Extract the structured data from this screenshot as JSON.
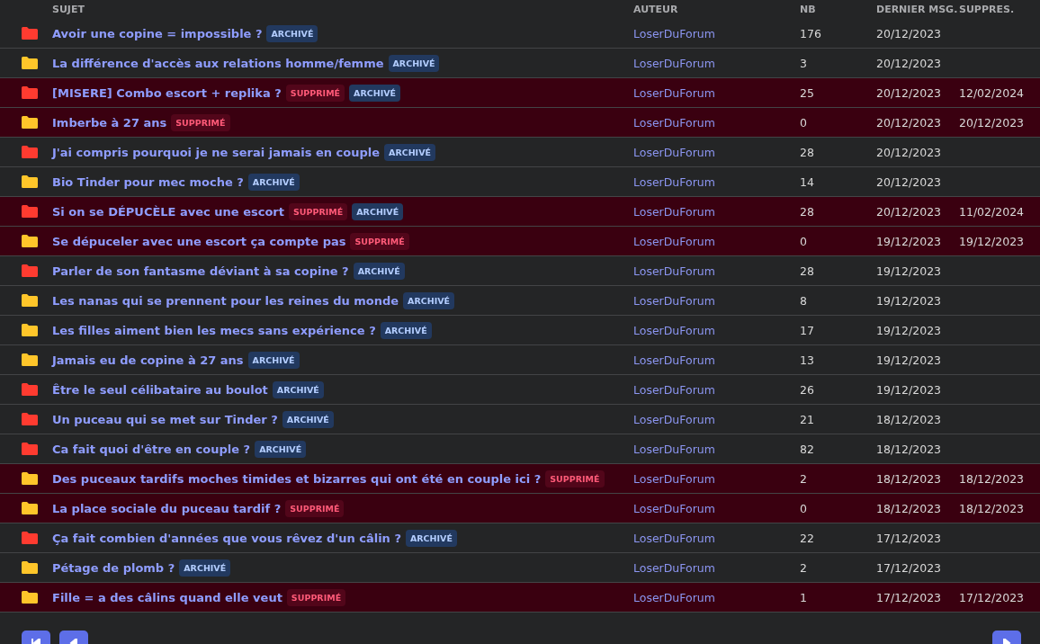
{
  "table": {
    "columns": [
      "SUJET",
      "AUTEUR",
      "NB",
      "DERNIER MSG.",
      "SUPPRES."
    ],
    "rows": [
      {
        "color": "#ff3b30",
        "title": "Avoir une copine = impossible ?",
        "deleted": false,
        "tags": [
          {
            "kind": "archived",
            "label": "ARCHIVÉ"
          }
        ],
        "author": "LoserDuForum",
        "count": "176",
        "last": "20/12/2023"
      },
      {
        "color": "#ffc62a",
        "title": "La différence d'accès aux relations homme/femme",
        "deleted": false,
        "tags": [
          {
            "kind": "archived",
            "label": "ARCHIVÉ"
          }
        ],
        "author": "LoserDuForum",
        "count": "3",
        "last": "20/12/2023"
      },
      {
        "color": "#ff3b30",
        "title": "[MISERE] Combo escort + replika ?",
        "deleted": true,
        "tags": [
          {
            "kind": "deleted",
            "label": "SUPPRIMÉ"
          },
          {
            "kind": "archived",
            "label": "ARCHIVÉ"
          }
        ],
        "author": "LoserDuForum",
        "count": "25",
        "last": "20/12/2023",
        "deleted_on": "12/02/2024"
      },
      {
        "color": "#ffc62a",
        "title": "Imberbe à 27 ans",
        "deleted": true,
        "tags": [
          {
            "kind": "deleted",
            "label": "SUPPRIMÉ"
          }
        ],
        "author": "LoserDuForum",
        "count": "0",
        "last": "20/12/2023",
        "deleted_on": "20/12/2023"
      },
      {
        "color": "#ff3b30",
        "title": "J'ai compris pourquoi je ne serai jamais en couple",
        "deleted": false,
        "tags": [
          {
            "kind": "archived",
            "label": "ARCHIVÉ"
          }
        ],
        "author": "LoserDuForum",
        "count": "28",
        "last": "20/12/2023"
      },
      {
        "color": "#ffc62a",
        "title": "Bio Tinder pour mec moche ?",
        "deleted": false,
        "tags": [
          {
            "kind": "archived",
            "label": "ARCHIVÉ"
          }
        ],
        "author": "LoserDuForum",
        "count": "14",
        "last": "20/12/2023"
      },
      {
        "color": "#ff3b30",
        "title": "Si on se DÉPUCÈLE avec une escort",
        "deleted": true,
        "tags": [
          {
            "kind": "deleted",
            "label": "SUPPRIMÉ"
          },
          {
            "kind": "archived",
            "label": "ARCHIVÉ"
          }
        ],
        "author": "LoserDuForum",
        "count": "28",
        "last": "20/12/2023",
        "deleted_on": "11/02/2024"
      },
      {
        "color": "#ffc62a",
        "title": "Se dépuceler avec une escort ça compte pas",
        "deleted": true,
        "tags": [
          {
            "kind": "deleted",
            "label": "SUPPRIMÉ"
          }
        ],
        "author": "LoserDuForum",
        "count": "0",
        "last": "19/12/2023",
        "deleted_on": "19/12/2023"
      },
      {
        "color": "#ff3b30",
        "title": "Parler de son fantasme déviant à sa copine ?",
        "deleted": false,
        "tags": [
          {
            "kind": "archived",
            "label": "ARCHIVÉ"
          }
        ],
        "author": "LoserDuForum",
        "count": "28",
        "last": "19/12/2023"
      },
      {
        "color": "#ffc62a",
        "title": "Les nanas qui se prennent pour les reines du monde",
        "deleted": false,
        "tags": [
          {
            "kind": "archived",
            "label": "ARCHIVÉ"
          }
        ],
        "author": "LoserDuForum",
        "count": "8",
        "last": "19/12/2023"
      },
      {
        "color": "#ffc62a",
        "title": "Les filles aiment bien les mecs sans expérience ?",
        "deleted": false,
        "tags": [
          {
            "kind": "archived",
            "label": "ARCHIVÉ"
          }
        ],
        "author": "LoserDuForum",
        "count": "17",
        "last": "19/12/2023"
      },
      {
        "color": "#ffc62a",
        "title": "Jamais eu de copine à 27 ans",
        "deleted": false,
        "tags": [
          {
            "kind": "archived",
            "label": "ARCHIVÉ"
          }
        ],
        "author": "LoserDuForum",
        "count": "13",
        "last": "19/12/2023"
      },
      {
        "color": "#ff3b30",
        "title": "Être le seul célibataire au boulot",
        "deleted": false,
        "tags": [
          {
            "kind": "archived",
            "label": "ARCHIVÉ"
          }
        ],
        "author": "LoserDuForum",
        "count": "26",
        "last": "19/12/2023"
      },
      {
        "color": "#ff3b30",
        "title": "Un puceau qui se met sur Tinder ?",
        "deleted": false,
        "tags": [
          {
            "kind": "archived",
            "label": "ARCHIVÉ"
          }
        ],
        "author": "LoserDuForum",
        "count": "21",
        "last": "18/12/2023"
      },
      {
        "color": "#ff3b30",
        "title": "Ca fait quoi d'être en couple ?",
        "deleted": false,
        "tags": [
          {
            "kind": "archived",
            "label": "ARCHIVÉ"
          }
        ],
        "author": "LoserDuForum",
        "count": "82",
        "last": "18/12/2023"
      },
      {
        "color": "#ffc62a",
        "title": "Des puceaux tardifs moches timides et bizarres qui ont été en couple ici ?",
        "deleted": true,
        "tags": [
          {
            "kind": "deleted",
            "label": "SUPPRIMÉ"
          }
        ],
        "author": "LoserDuForum",
        "count": "2",
        "last": "18/12/2023",
        "deleted_on": "18/12/2023"
      },
      {
        "color": "#ffc62a",
        "title": "La place sociale du puceau tardif ?",
        "deleted": true,
        "tags": [
          {
            "kind": "deleted",
            "label": "SUPPRIMÉ"
          }
        ],
        "author": "LoserDuForum",
        "count": "0",
        "last": "18/12/2023",
        "deleted_on": "18/12/2023"
      },
      {
        "color": "#ff3b30",
        "title": "Ça fait combien d'années que vous rêvez d'un câlin ?",
        "deleted": false,
        "tags": [
          {
            "kind": "archived",
            "label": "ARCHIVÉ"
          }
        ],
        "author": "LoserDuForum",
        "count": "22",
        "last": "17/12/2023"
      },
      {
        "color": "#ffc62a",
        "title": "Pétage de plomb ?",
        "deleted": false,
        "tags": [
          {
            "kind": "archived",
            "label": "ARCHIVÉ"
          }
        ],
        "author": "LoserDuForum",
        "count": "2",
        "last": "17/12/2023"
      },
      {
        "color": "#ffc62a",
        "title": "Fille = a des câlins quand elle veut",
        "deleted": true,
        "tags": [
          {
            "kind": "deleted",
            "label": "SUPPRIMÉ"
          }
        ],
        "author": "LoserDuForum",
        "count": "1",
        "last": "17/12/2023",
        "deleted_on": "17/12/2023"
      }
    ]
  },
  "pagination": {
    "buttons": [
      {
        "kind": "first"
      },
      {
        "kind": "prev"
      },
      {
        "kind": "next"
      }
    ]
  }
}
